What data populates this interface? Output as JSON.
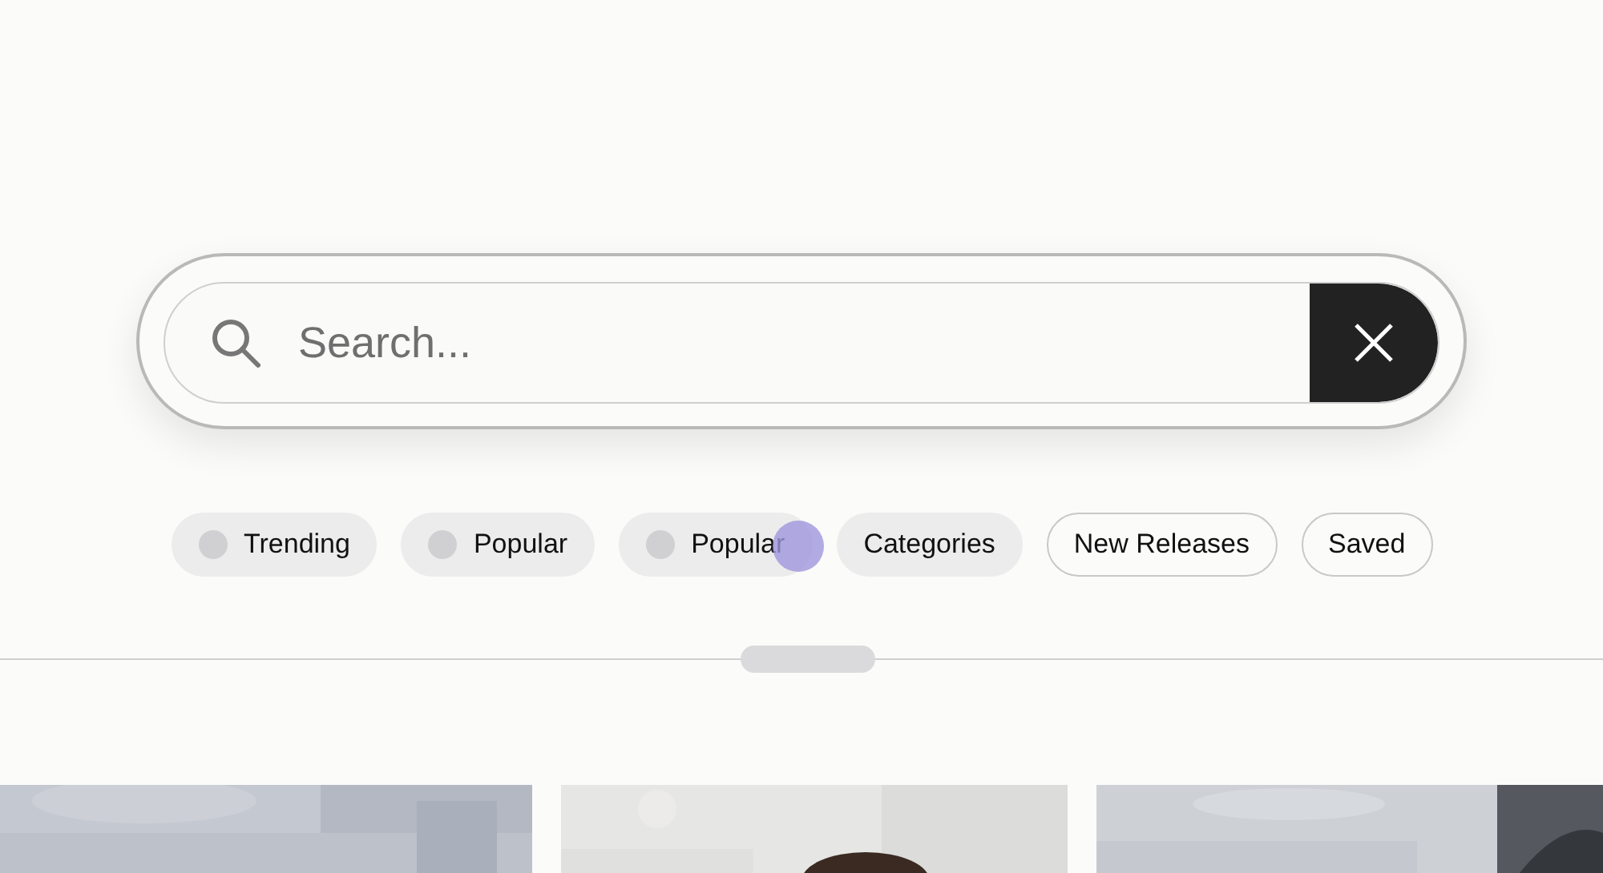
{
  "search": {
    "placeholder": "Search..."
  },
  "chips": [
    {
      "label": "Trending",
      "kind": "filled",
      "dot": true,
      "pointer": false
    },
    {
      "label": "Popular",
      "kind": "filled",
      "dot": true,
      "pointer": false
    },
    {
      "label": "Popular",
      "kind": "filled",
      "dot": true,
      "pointer": true
    },
    {
      "label": "Categories",
      "kind": "filled",
      "dot": false,
      "pointer": false
    },
    {
      "label": "New Releases",
      "kind": "outlined",
      "dot": false,
      "pointer": false
    },
    {
      "label": "Saved",
      "kind": "outlined",
      "dot": false,
      "pointer": false
    }
  ]
}
